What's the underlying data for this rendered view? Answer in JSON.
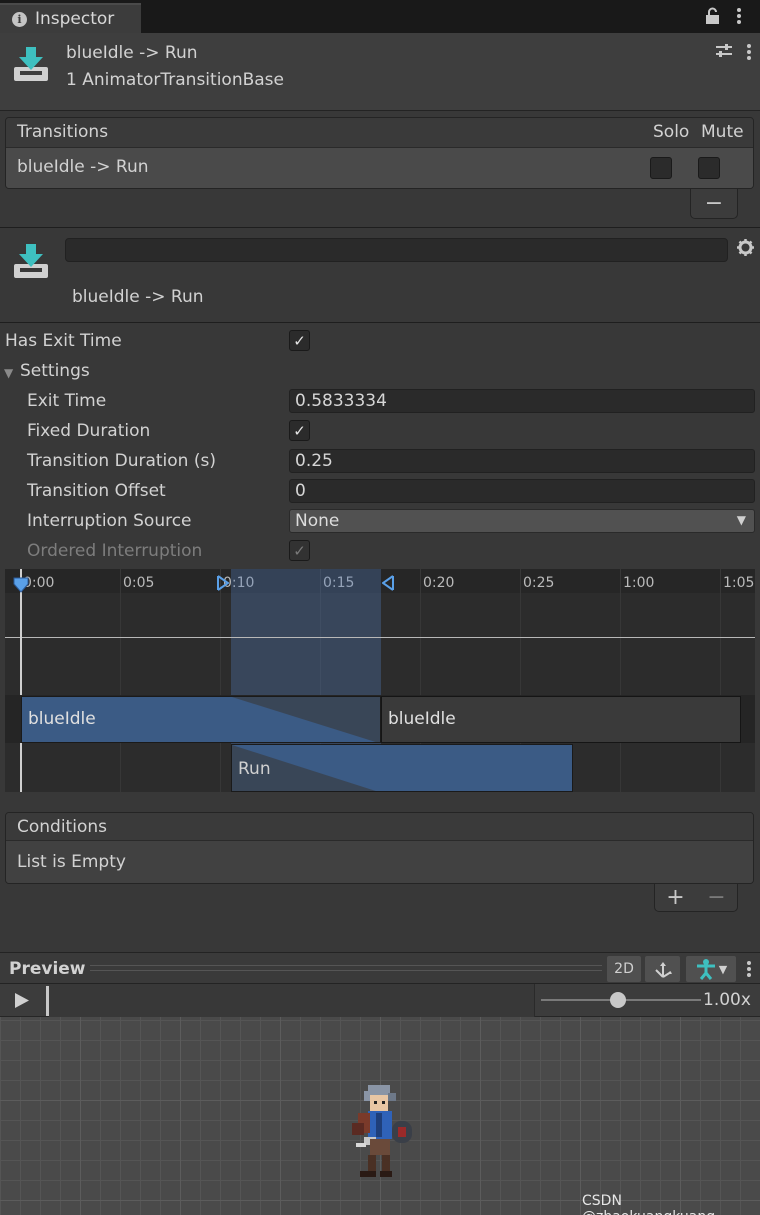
{
  "window": {
    "tab_title": "Inspector"
  },
  "header": {
    "title": "blueIdle -> Run",
    "subtitle": "1 AnimatorTransitionBase"
  },
  "transitions": {
    "header": "Transitions",
    "col_solo": "Solo",
    "col_mute": "Mute",
    "rows": [
      {
        "name": "blueIdle -> Run",
        "solo": false,
        "mute": false
      }
    ],
    "remove_label": "−"
  },
  "transition_detail": {
    "name_field": "",
    "label": "blueIdle -> Run"
  },
  "has_exit_time": {
    "label": "Has Exit Time",
    "checked": true
  },
  "settings": {
    "label": "Settings",
    "exit_time": {
      "label": "Exit Time",
      "value": "0.5833334"
    },
    "fixed_duration": {
      "label": "Fixed Duration",
      "checked": true
    },
    "transition_duration": {
      "label": "Transition Duration (s)",
      "value": "0.25"
    },
    "transition_offset": {
      "label": "Transition Offset",
      "value": "0"
    },
    "interruption_source": {
      "label": "Interruption Source",
      "value": "None"
    },
    "ordered_interruption": {
      "label": "Ordered Interruption",
      "checked": true
    }
  },
  "timeline": {
    "ticks": [
      "0:00",
      "0:05",
      "0:10",
      "0:15",
      "0:20",
      "0:25",
      "1:00",
      "1:05"
    ],
    "source_clip": "blueIdle",
    "source_clip_repeat": "blueIdle",
    "dest_clip": "Run"
  },
  "conditions": {
    "header": "Conditions",
    "empty_text": "List is Empty",
    "add_label": "+",
    "remove_label": "−"
  },
  "preview": {
    "title": "Preview",
    "mode_2d": "2D",
    "speed": "1.00x"
  },
  "watermark": "CSDN @zhaokuangkuang_",
  "colors": {
    "accent": "#3a5e8c",
    "timeline_highlight": "#3b5372",
    "panel": "#383838"
  }
}
